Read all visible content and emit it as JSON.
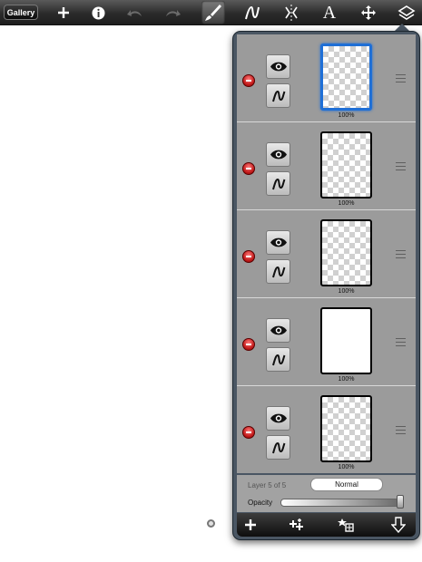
{
  "toolbar": {
    "gallery_label": "Gallery",
    "icons": [
      "plus-icon",
      "info-icon",
      "undo-icon",
      "redo-icon",
      "brush-icon",
      "smudge-icon",
      "symmetry-icon",
      "text-icon",
      "transform-icon",
      "layers-icon"
    ]
  },
  "layers": [
    {
      "opacity": "100%",
      "selected": true,
      "solid": false
    },
    {
      "opacity": "100%",
      "selected": false,
      "solid": false
    },
    {
      "opacity": "100%",
      "selected": false,
      "solid": false
    },
    {
      "opacity": "100%",
      "selected": false,
      "solid": true
    },
    {
      "opacity": "100%",
      "selected": false,
      "solid": false
    }
  ],
  "layer_panel": {
    "layer_info": "Layer 5 of 5",
    "blend_mode": "Normal",
    "opacity_label": "Opacity",
    "opacity_value": 1.0,
    "bottom_icons": [
      "add-layer-icon",
      "duplicate-layer-icon",
      "merge-layer-icon",
      "merge-down-icon"
    ]
  },
  "colors": {
    "selected": "#1f6fd6",
    "delete": "#c01818",
    "panel": "#4a5663"
  }
}
